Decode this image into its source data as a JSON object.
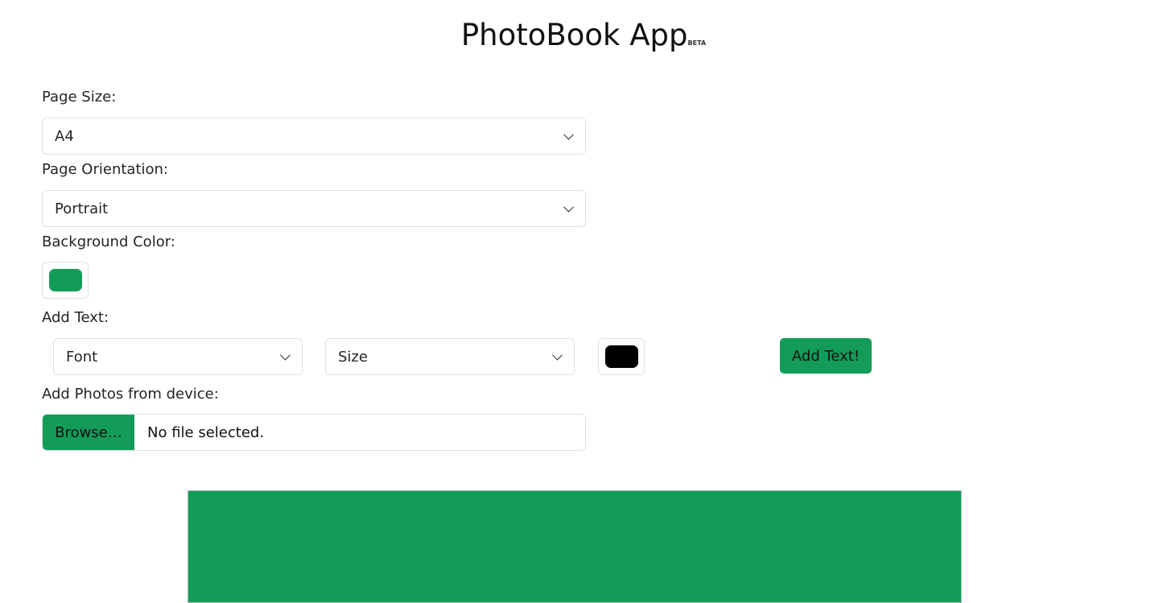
{
  "header": {
    "title": "PhotoBook App",
    "badge": "BETA"
  },
  "colors": {
    "accent": "#139c59",
    "text_color_value": "#000000",
    "background_color_value": "#139c59"
  },
  "page_size": {
    "label": "Page Size:",
    "value": "A4"
  },
  "page_orientation": {
    "label": "Page Orientation:",
    "value": "Portrait"
  },
  "background_color": {
    "label": "Background Color:",
    "value": "#139c59"
  },
  "add_text": {
    "label": "Add Text:",
    "font_select": "Font",
    "size_select": "Size",
    "color_value": "#000000",
    "button_label": "Add Text!"
  },
  "add_photos": {
    "label": "Add Photos from device:",
    "browse_label": "Browse…",
    "file_status": "No file selected."
  }
}
